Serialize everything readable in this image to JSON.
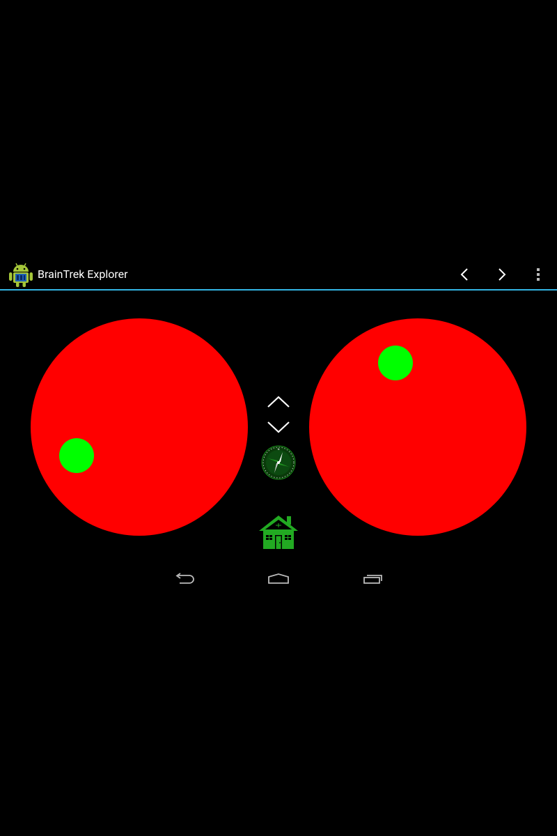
{
  "action_bar": {
    "title": "BrainTrek Explorer",
    "app_icon": "android-robot-icon",
    "prev_icon": "chevron-left-icon",
    "next_icon": "chevron-right-icon",
    "overflow_icon": "overflow-menu-icon",
    "divider_color": "#33b5e5"
  },
  "joysticks": {
    "pad_color": "#ff0000",
    "knob_color": "#00ff00"
  },
  "center_controls": {
    "up_icon": "chevron-up-icon",
    "down_icon": "chevron-down-icon",
    "compass_icon": "compass-icon",
    "home_icon": "house-icon",
    "home_color": "#22aa22"
  },
  "nav_bar": {
    "back_icon": "back-arrow-icon",
    "home_icon": "home-outline-icon",
    "recents_icon": "recent-apps-icon"
  }
}
